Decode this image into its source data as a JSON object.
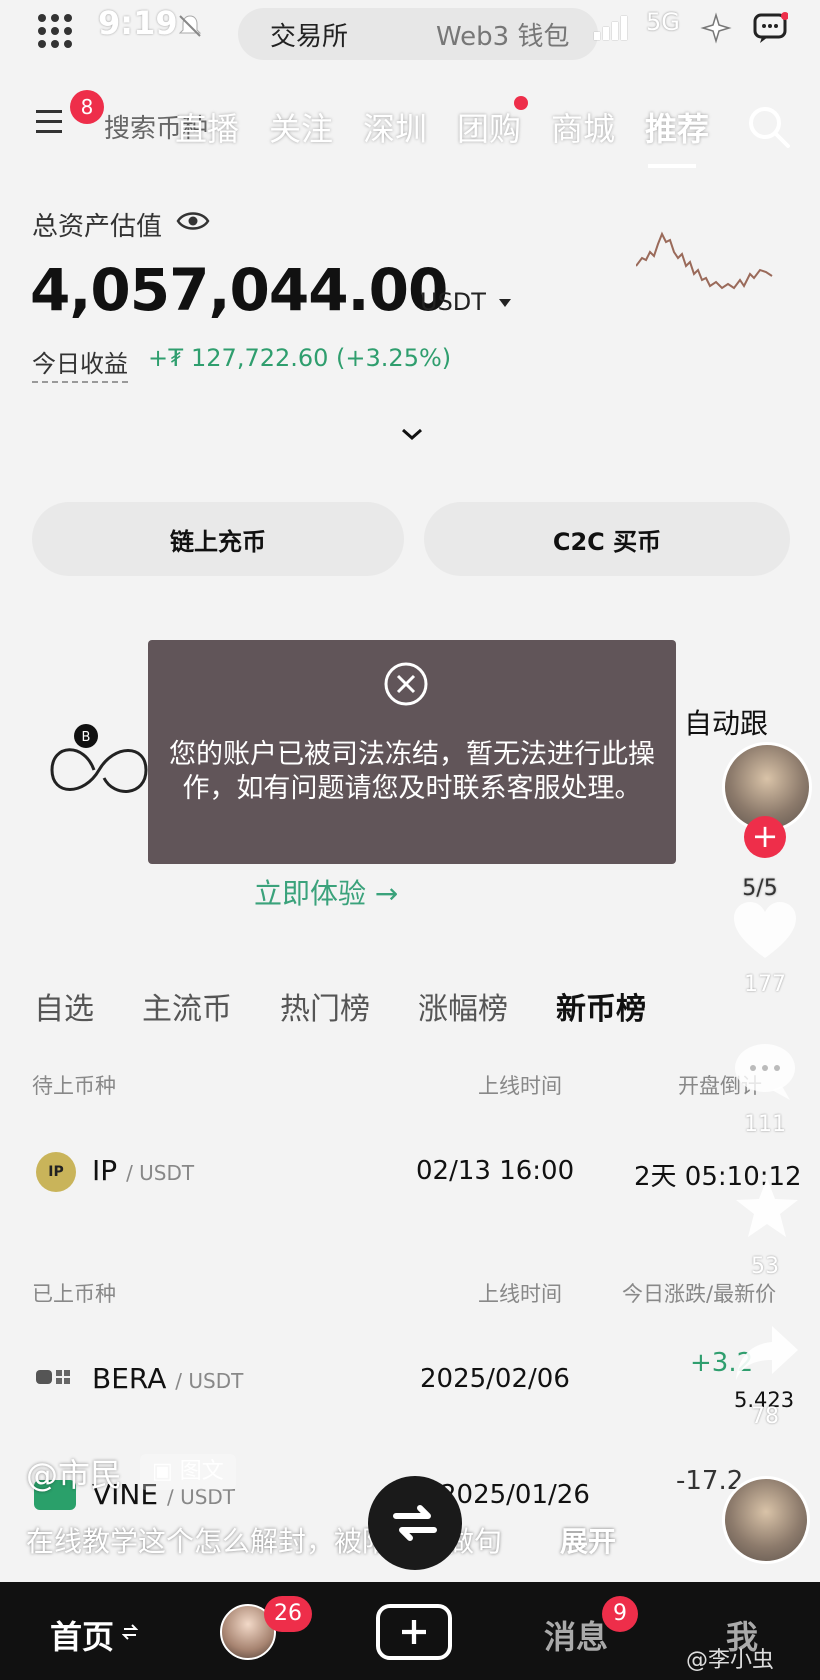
{
  "status_bar": {
    "time": "9:19",
    "exchange_tab": "交易所",
    "wallet_tab": "Web3 钱包",
    "network": "5G"
  },
  "header": {
    "menu_badge": "8",
    "search_placeholder": "搜索币种",
    "nav_tabs": [
      "直播",
      "关注",
      "深圳",
      "团购",
      "商城",
      "推荐"
    ],
    "active_tab": "推荐"
  },
  "asset": {
    "label": "总资产估值",
    "value": "4,057,044.00",
    "unit": "USDT",
    "today_label": "今日收益",
    "today_value": "+₮ 127,722.60 (+3.25%)"
  },
  "actions": {
    "deposit": "链上充币",
    "c2c": "C2C 买币"
  },
  "promo": {
    "try_now": "立即体验 →",
    "side_text": "自动跟"
  },
  "toast": {
    "message": "您的账户已被司法冻结，暂无法进行此操作，如有问题请您及时联系客服处理。"
  },
  "market": {
    "tabs": [
      "自选",
      "主流币",
      "热门榜",
      "涨幅榜",
      "新币榜"
    ],
    "active_tab": "新币榜",
    "upcoming_header": {
      "col1": "待上币种",
      "col2": "上线时间",
      "col3": "开盘倒计"
    },
    "upcoming": [
      {
        "symbol": "IP",
        "quote": "/ USDT",
        "time": "02/13 16:00",
        "countdown": "2天 05:10:12"
      }
    ],
    "listed_header": {
      "col1": "已上币种",
      "col2": "上线时间",
      "col3": "今日涨跌/最新价"
    },
    "listed": [
      {
        "symbol": "BERA",
        "quote": "/ USDT",
        "date": "2025/02/06",
        "change": "+3.2",
        "price": "5.423"
      },
      {
        "symbol": "VINE",
        "quote": "/ USDT",
        "date": "2025/01/26",
        "change": "-17.2"
      }
    ]
  },
  "rail": {
    "page_indicator": "5/5",
    "likes": "177",
    "comments": "111",
    "favorites": "53",
    "shares": "78"
  },
  "caption": {
    "author": "@市民",
    "tag": "图文",
    "text": "在线教学这个怎么解封，被陌生人做句",
    "expand": "展开"
  },
  "bottom_bar": {
    "home": "首页",
    "friends_badge": "26",
    "messages": "消息",
    "messages_badge": "9",
    "me": "我",
    "watermark": "@李小虫"
  }
}
